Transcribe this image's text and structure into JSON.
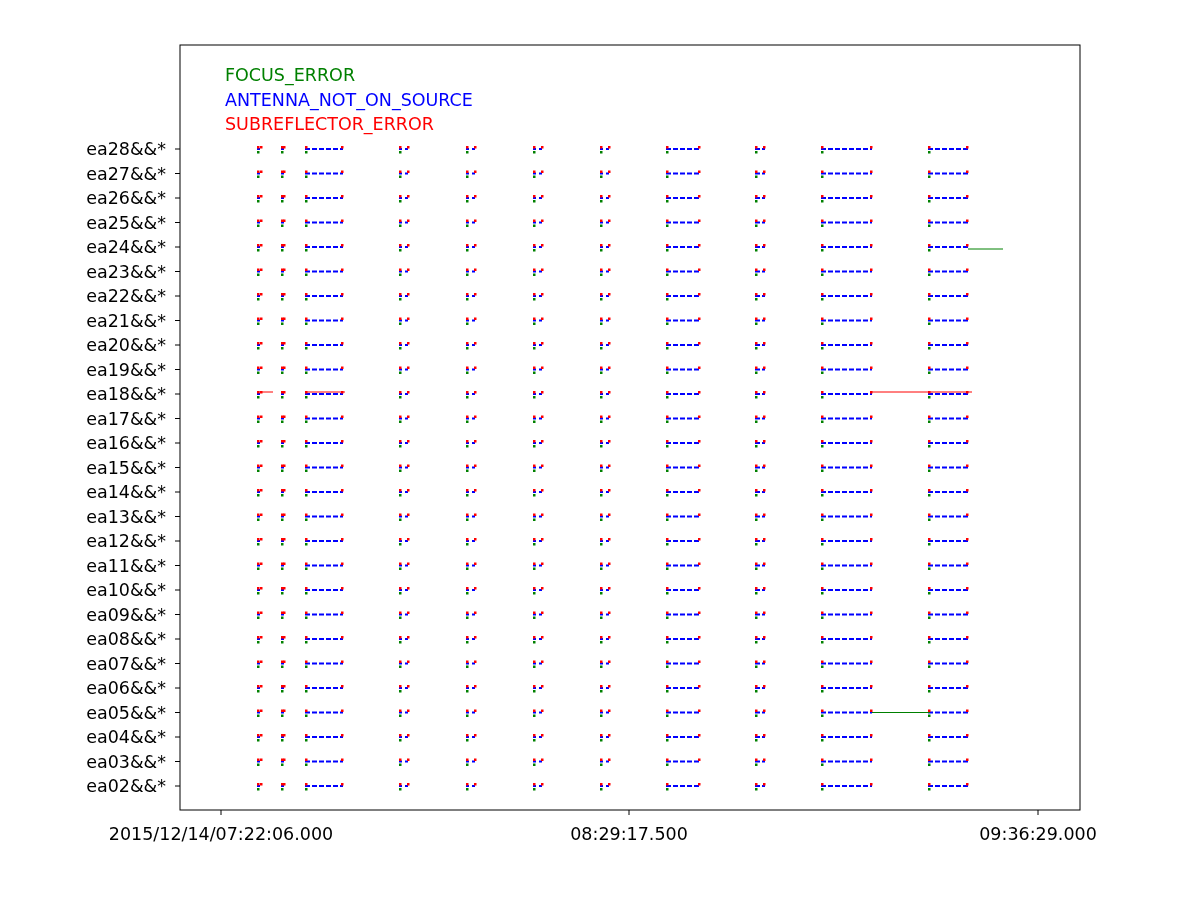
{
  "legend": [
    {
      "label": "FOCUS_ERROR",
      "color": "#008000"
    },
    {
      "label": "ANTENNA_NOT_ON_SOURCE",
      "color": "#0000ff"
    },
    {
      "label": "SUBREFLECTOR_ERROR",
      "color": "#ff0000"
    }
  ],
  "y_labels": [
    "ea28&&*",
    "ea27&&*",
    "ea26&&*",
    "ea25&&*",
    "ea24&&*",
    "ea23&&*",
    "ea22&&*",
    "ea21&&*",
    "ea20&&*",
    "ea19&&*",
    "ea18&&*",
    "ea17&&*",
    "ea16&&*",
    "ea15&&*",
    "ea14&&*",
    "ea13&&*",
    "ea12&&*",
    "ea11&&*",
    "ea10&&*",
    "ea09&&*",
    "ea08&&*",
    "ea07&&*",
    "ea06&&*",
    "ea05&&*",
    "ea04&&*",
    "ea03&&*",
    "ea02&&*"
  ],
  "x_labels": [
    "2015/12/14/07:22:06.000",
    "08:29:17.500",
    "09:36:29.000"
  ]
}
